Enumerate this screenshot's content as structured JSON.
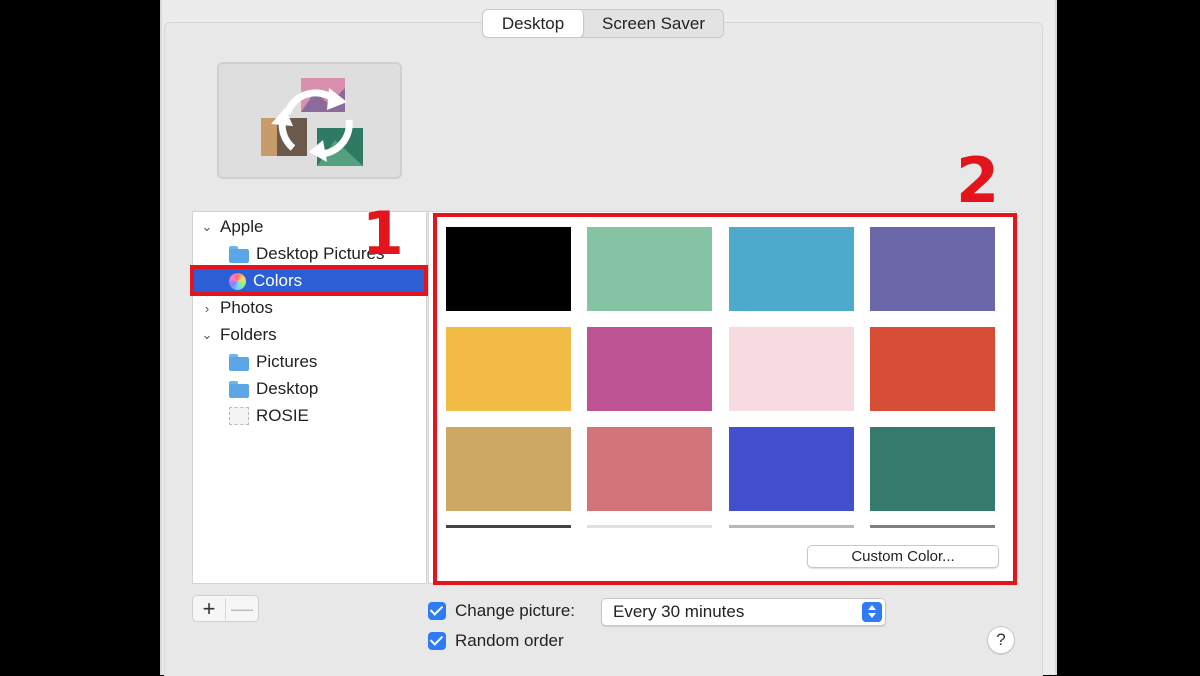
{
  "tabs": [
    {
      "label": "Desktop",
      "active": true
    },
    {
      "label": "Screen Saver",
      "active": false
    }
  ],
  "sidebar": {
    "items": [
      {
        "label": "Apple",
        "type": "group",
        "expanded": true
      },
      {
        "label": "Desktop Pictures",
        "type": "child",
        "icon": "folder-icon"
      },
      {
        "label": "Colors",
        "type": "child",
        "icon": "colors-icon",
        "selected": true
      },
      {
        "label": "Photos",
        "type": "group",
        "expanded": false
      },
      {
        "label": "Folders",
        "type": "group",
        "expanded": true
      },
      {
        "label": "Pictures",
        "type": "child",
        "icon": "folder-icon"
      },
      {
        "label": "Desktop",
        "type": "child",
        "icon": "folder-icon"
      },
      {
        "label": "ROSIE",
        "type": "child",
        "icon": "drive-icon"
      }
    ],
    "add_label": "+",
    "remove_label": "—"
  },
  "swatches": [
    "#000000",
    "#84c4a5",
    "#4eaacd",
    "#6b67a9",
    "#f1bb45",
    "#bd5393",
    "#f6dbe1",
    "#d84d36",
    "#cca864",
    "#d17479",
    "#424fce",
    "#357a6d"
  ],
  "partial_swatch_strips": [
    "#444444",
    "#e0e0e0",
    "#b8b8b8",
    "#808080"
  ],
  "custom_color_label": "Custom Color...",
  "options": {
    "change_picture_label": "Change picture:",
    "change_picture_checked": true,
    "interval_value": "Every 30 minutes",
    "random_order_label": "Random order",
    "random_order_checked": true
  },
  "help_label": "?",
  "annotations": {
    "marker_1": "1",
    "marker_2": "2",
    "color": "#e3141b"
  }
}
